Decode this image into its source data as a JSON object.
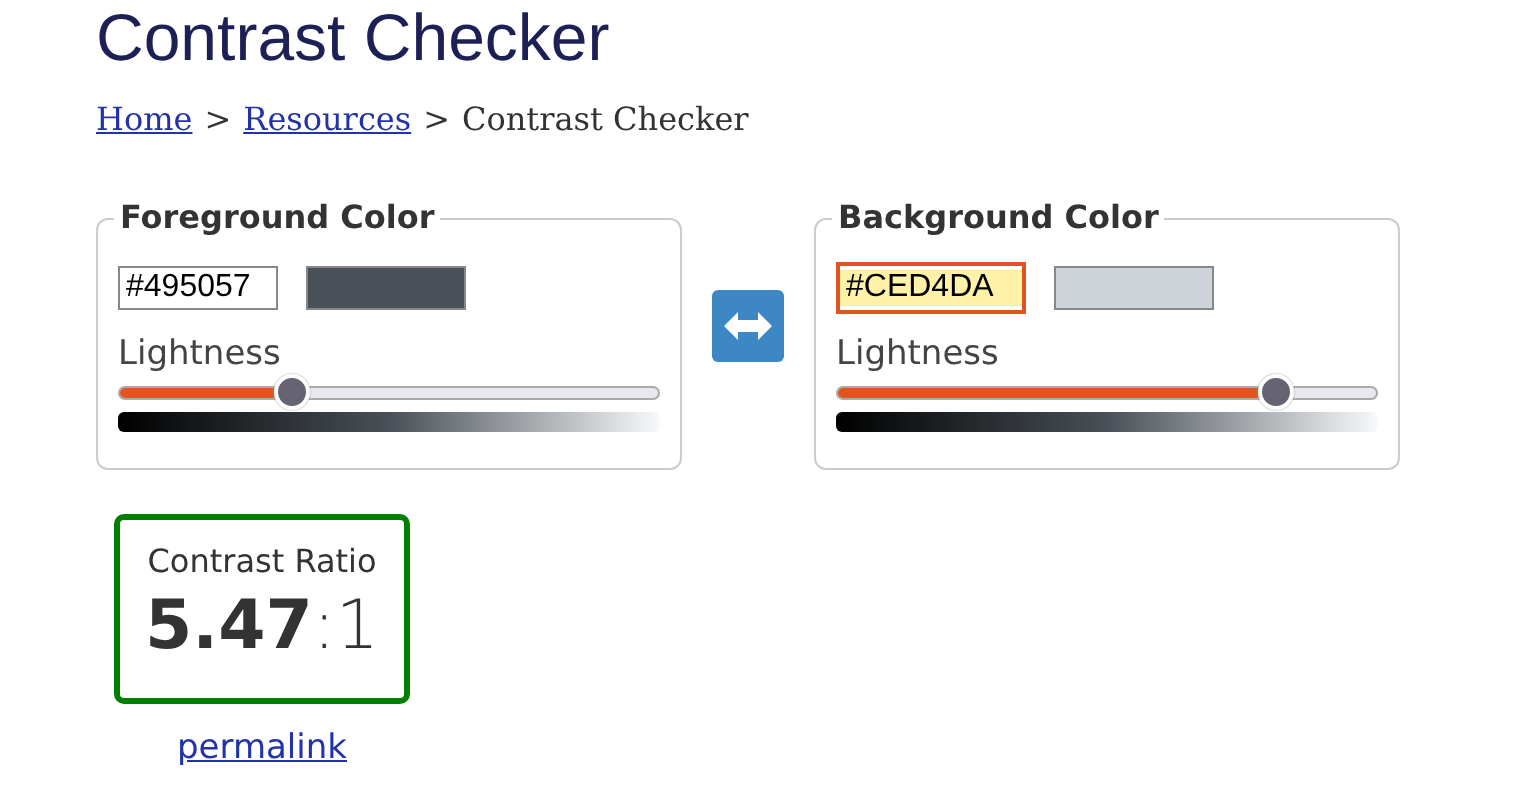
{
  "title": "Contrast Checker",
  "breadcrumb": [
    {
      "kind": "link",
      "text": "Home"
    },
    {
      "kind": "separator",
      "text": ">"
    },
    {
      "kind": "link",
      "text": "Resources"
    },
    {
      "kind": "separator",
      "text": ">"
    },
    {
      "kind": "current",
      "text": "Contrast Checker"
    }
  ],
  "panels": [
    {
      "legend": "Foreground Color",
      "value": "#495057",
      "focused": false,
      "slider_label": "Lightness",
      "level": 0.32
    },
    {
      "legend": "Background Color",
      "value": "#CED4DA",
      "focused": true,
      "slider_label": "Lightness",
      "level": 0.81
    }
  ],
  "result": {
    "label": "Contrast Ratio",
    "ratio": "**5.47**:1",
    "passes": true
  },
  "permalink": "permalink"
}
